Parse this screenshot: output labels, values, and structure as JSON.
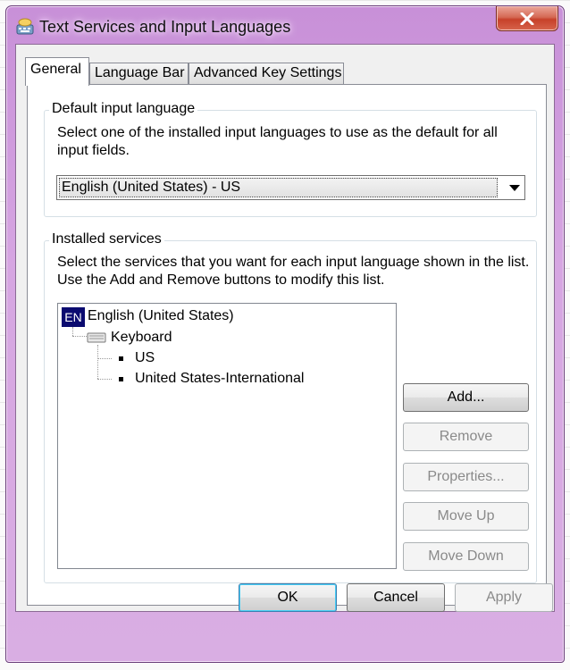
{
  "window": {
    "title": "Text Services and Input Languages"
  },
  "tabs": [
    {
      "label": "General",
      "active": true
    },
    {
      "label": "Language Bar",
      "active": false
    },
    {
      "label": "Advanced Key Settings",
      "active": false
    }
  ],
  "default_input": {
    "group_label": "Default input language",
    "description_line1": "Select one of the installed input languages to use as the default for all",
    "description_line2": "input fields.",
    "selected_value": "English (United States) - US"
  },
  "installed_services": {
    "group_label": "Installed services",
    "description_line1": "Select the services that you want for each input language shown in the list.",
    "description_line2": "Use the Add and Remove buttons to modify this list.",
    "tree": {
      "language_badge": "EN",
      "language": "English (United States)",
      "category": "Keyboard",
      "items": [
        "US",
        "United States-International"
      ]
    },
    "buttons": {
      "add": "Add...",
      "remove": "Remove",
      "properties": "Properties...",
      "move_up": "Move Up",
      "move_down": "Move Down"
    }
  },
  "footer": {
    "ok": "OK",
    "cancel": "Cancel",
    "apply": "Apply"
  },
  "colors": {
    "titlebar": "#c890d8",
    "close": "#c7412a",
    "badge": "#0b0b70"
  }
}
